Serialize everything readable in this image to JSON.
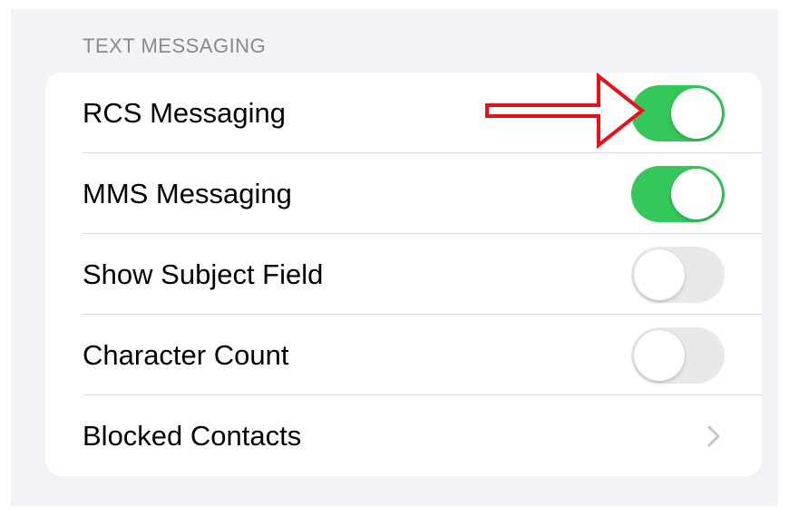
{
  "section": {
    "header": "TEXT MESSAGING"
  },
  "rows": [
    {
      "label": "RCS Messaging",
      "control": "toggle",
      "on": true
    },
    {
      "label": "MMS Messaging",
      "control": "toggle",
      "on": true
    },
    {
      "label": "Show Subject Field",
      "control": "toggle",
      "on": false
    },
    {
      "label": "Character Count",
      "control": "toggle",
      "on": false
    },
    {
      "label": "Blocked Contacts",
      "control": "disclosure",
      "icon": "chevron-right-icon"
    }
  ],
  "annotation": {
    "icon": "red-arrow-icon",
    "color": "#e8101a",
    "target": "RCS Messaging toggle"
  },
  "colors": {
    "toggle_on": "#34c759",
    "toggle_off": "#e9e9eb",
    "background": "#f2f2f7",
    "section_header": "#8a8a8e"
  }
}
